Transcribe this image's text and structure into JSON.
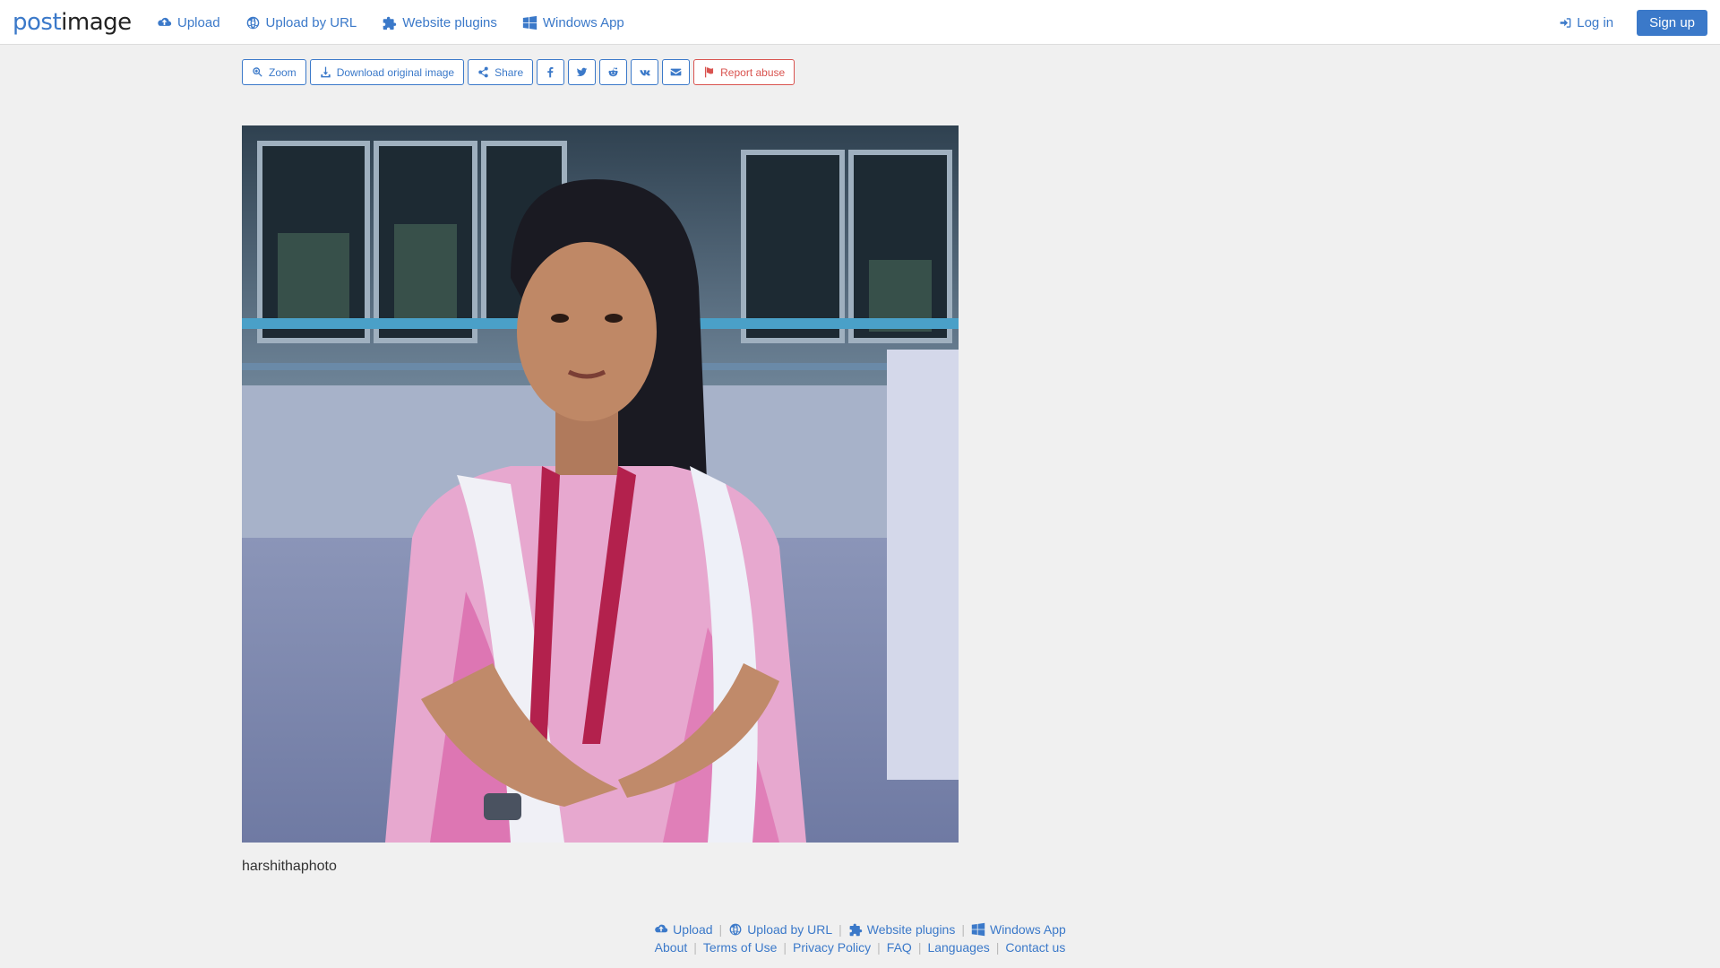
{
  "header": {
    "logo_part1": "post",
    "logo_part2": "image",
    "nav": {
      "upload": "Upload",
      "upload_url": "Upload by URL",
      "plugins": "Website plugins",
      "windows": "Windows App"
    },
    "login": "Log in",
    "signup": "Sign up"
  },
  "toolbar": {
    "zoom": "Zoom",
    "download": "Download original image",
    "share": "Share",
    "report": "Report abuse"
  },
  "image": {
    "caption": "harshithaphoto"
  },
  "footer": {
    "row1": {
      "upload": "Upload",
      "upload_url": "Upload by URL",
      "plugins": "Website plugins",
      "windows": "Windows App"
    },
    "row2": {
      "about": "About",
      "terms": "Terms of Use",
      "privacy": "Privacy Policy",
      "faq": "FAQ",
      "languages": "Languages",
      "contact": "Contact us"
    }
  },
  "colors": {
    "accent": "#3b79c9",
    "danger": "#d9534f",
    "background": "#f0f0f0"
  }
}
